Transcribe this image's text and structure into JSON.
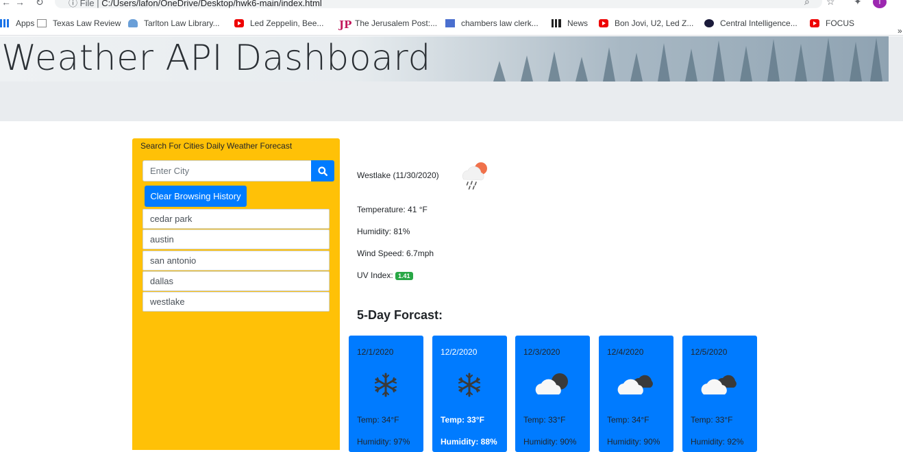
{
  "browser": {
    "url_prefix": "File",
    "url": "C:/Users/lafon/OneDrive/Desktop/hwk6-main/index.html",
    "profile_initial": "T",
    "bookmarks": [
      {
        "label": "Apps",
        "icon": "apps-grid-icon"
      },
      {
        "label": "Texas Law Review",
        "icon": "tlr-icon"
      },
      {
        "label": "Tarlton Law Library...",
        "icon": "cloud-icon"
      },
      {
        "label": "Led Zeppelin, Bee...",
        "icon": "youtube-icon"
      },
      {
        "label": "The Jerusalem Post:...",
        "icon": "jp-icon"
      },
      {
        "label": "chambers law clerk...",
        "icon": "bookmark-page-icon"
      },
      {
        "label": "News",
        "icon": "news-icon"
      },
      {
        "label": "Bon Jovi, U2, Led Z...",
        "icon": "youtube-icon"
      },
      {
        "label": "Central Intelligence...",
        "icon": "cia-icon"
      },
      {
        "label": "FOCUS",
        "icon": "youtube-icon"
      }
    ]
  },
  "header": {
    "title": "Weather API Dashboard"
  },
  "sidebar": {
    "heading": "Search For Cities Daily Weather Forecast",
    "search_placeholder": "Enter City",
    "search_icon": "search-icon",
    "clear_label": "Clear Browsing History",
    "history": [
      "cedar park",
      "austin",
      "san antonio",
      "dallas",
      "westlake"
    ]
  },
  "current": {
    "city_date": "Westlake (11/30/2020)",
    "icon": "rain-sun-icon",
    "temperature": "Temperature: 41 °F",
    "humidity": "Humidity: 81%",
    "wind": "Wind Speed: 6.7mph",
    "uv_label": "UV Index:",
    "uv_value": "1.41",
    "uv_color": "#28a745"
  },
  "forecast": {
    "title": "5-Day Forcast:",
    "days": [
      {
        "date": "12/1/2020",
        "icon": "snowflake-icon",
        "temp": "Temp: 34°F",
        "humidity": "Humidity: 97%"
      },
      {
        "date": "12/2/2020",
        "icon": "snowflake-icon",
        "temp": "Temp: 33°F",
        "humidity": "Humidity: 88%"
      },
      {
        "date": "12/3/2020",
        "icon": "cloudy-icon",
        "temp": "Temp: 33°F",
        "humidity": "Humidity: 90%"
      },
      {
        "date": "12/4/2020",
        "icon": "cloudy-icon",
        "temp": "Temp: 34°F",
        "humidity": "Humidity: 90%"
      },
      {
        "date": "12/5/2020",
        "icon": "cloudy-icon",
        "temp": "Temp: 33°F",
        "humidity": "Humidity: 92%"
      }
    ]
  },
  "colors": {
    "primary": "#007bff",
    "sidebar": "#ffc107",
    "jumbotron": "#e9ecef"
  }
}
